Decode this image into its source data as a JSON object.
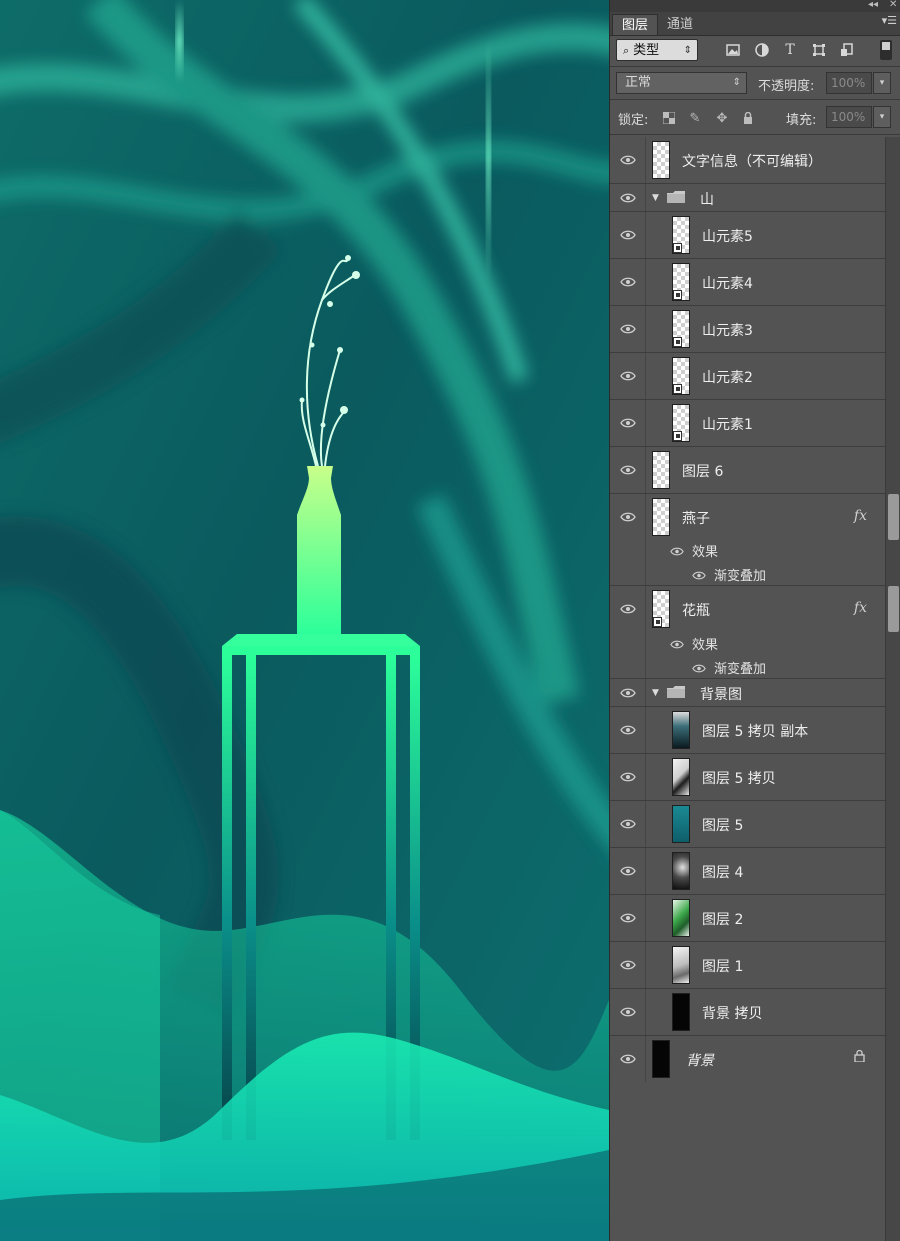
{
  "colors": {
    "panel_bg": "#535353",
    "canvas_bg": "#0a5c5c",
    "accent_green": "#2cff9a",
    "teal_dark": "#063f46"
  },
  "panel": {
    "tabs": [
      {
        "label": "图层",
        "active": true
      },
      {
        "label": "通道",
        "active": false
      }
    ],
    "filter": {
      "label": "类型",
      "icons": [
        "image-filter-icon",
        "adjustment-filter-icon",
        "type-filter-icon",
        "shape-filter-icon",
        "smartobject-filter-icon"
      ]
    },
    "blend_mode": "正常",
    "opacity_label": "不透明度:",
    "opacity_value": "100%",
    "lock_label": "锁定:",
    "fill_label": "填充:",
    "fill_value": "100%"
  },
  "layers": [
    {
      "name": "文字信息（不可编辑）",
      "kind": "layer"
    },
    {
      "name": "山",
      "kind": "group"
    },
    {
      "name": "山元素5",
      "kind": "smart",
      "indent": true
    },
    {
      "name": "山元素4",
      "kind": "smart",
      "indent": true
    },
    {
      "name": "山元素3",
      "kind": "smart",
      "indent": true
    },
    {
      "name": "山元素2",
      "kind": "smart",
      "indent": true
    },
    {
      "name": "山元素1",
      "kind": "smart",
      "indent": true
    },
    {
      "name": "图层 6",
      "kind": "layer"
    },
    {
      "name": "燕子",
      "kind": "fx",
      "effects_label": "效果",
      "effect": "渐变叠加"
    },
    {
      "name": "花瓶",
      "kind": "fx-smart",
      "effects_label": "效果",
      "effect": "渐变叠加"
    },
    {
      "name": "背景图",
      "kind": "group"
    },
    {
      "name": "图层 5 拷贝 副本",
      "kind": "image",
      "indent": true
    },
    {
      "name": "图层 5 拷贝",
      "kind": "image",
      "indent": true
    },
    {
      "name": "图层 5",
      "kind": "image",
      "indent": true
    },
    {
      "name": "图层 4",
      "kind": "image",
      "indent": true
    },
    {
      "name": "图层 2",
      "kind": "image",
      "indent": true
    },
    {
      "name": "图层 1",
      "kind": "image",
      "indent": true
    },
    {
      "name": "背景 拷贝",
      "kind": "image",
      "indent": true
    },
    {
      "name": "背景",
      "kind": "background",
      "locked": true
    }
  ]
}
